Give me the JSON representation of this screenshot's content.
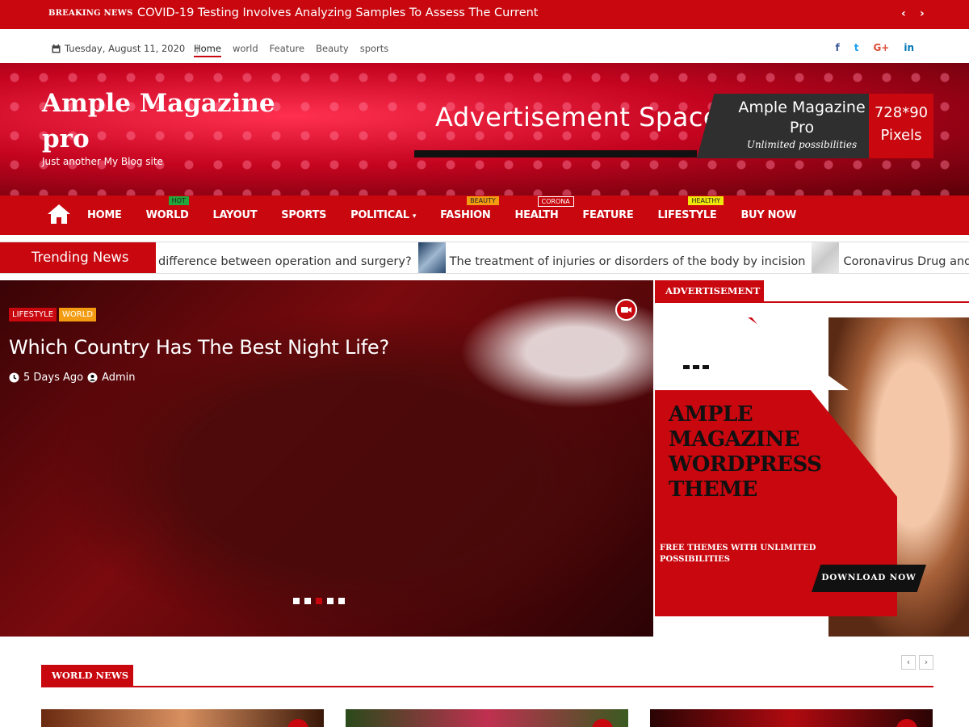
{
  "topbar": {
    "label": "BREAKING NEWS",
    "headline": "COVID-19 Testing Involves Analyzing Samples To Assess The Current",
    "prev": "‹",
    "next": "›"
  },
  "infobar": {
    "date": "Tuesday, August 11, 2020",
    "nav": [
      "Home",
      "world",
      "Feature",
      "Beauty",
      "sports"
    ],
    "social": [
      "f",
      "t",
      "G+",
      "in"
    ]
  },
  "site": {
    "title_line1": "Ample Magazine",
    "title_line2": "pro",
    "tagline": "Just another My Blog site"
  },
  "header_ad": {
    "text": "Advertisement Space",
    "brand1": "Ample Magazine",
    "brand2": "Pro",
    "slogan": "Unlimited possibilities",
    "size1": "728*90",
    "size2": "Pixels"
  },
  "mainnav": {
    "items": [
      {
        "label": "HOME",
        "badge": ""
      },
      {
        "label": "WORLD",
        "badge": "HOT"
      },
      {
        "label": "LAYOUT",
        "badge": ""
      },
      {
        "label": "SPORTS",
        "badge": ""
      },
      {
        "label": "POLITICAL",
        "badge": ""
      },
      {
        "label": "FASHION",
        "badge": "BEAUTY"
      },
      {
        "label": "HEALTH",
        "badge": "CORONA"
      },
      {
        "label": "FEATURE",
        "badge": ""
      },
      {
        "label": "LIFESTYLE",
        "badge": "HEALTHY"
      },
      {
        "label": "BUY NOW",
        "badge": ""
      }
    ]
  },
  "trending": {
    "label": "Trending News",
    "items": [
      "difference between operation and surgery?",
      "The treatment of injuries or disorders of the body by incision",
      "Coronavirus Drug and Trea"
    ]
  },
  "hero": {
    "cat1": "LIFESTYLE",
    "cat2": "WORLD",
    "title": "Which Country Has The Best Night Life?",
    "time": "5 Days Ago",
    "author": "Admin"
  },
  "sidebar": {
    "heading": "ADVERTISEMENT",
    "ad_headline_1": "AMPLE",
    "ad_headline_2": "MAGAZINE",
    "ad_headline_3": "WORDPRESS",
    "ad_headline_4": "THEME",
    "ad_sub": "FREE THEMES WITH UNLIMITED POSSIBILITIES",
    "ad_button": "DOWNLOAD NOW"
  },
  "worldnews": {
    "heading": "WORLD NEWS",
    "prev": "‹",
    "next": "›"
  },
  "colors": {
    "brand": "#c8070e",
    "hot": "#22a83a",
    "beauty": "#f39c12",
    "healthy": "#f1e60a"
  }
}
